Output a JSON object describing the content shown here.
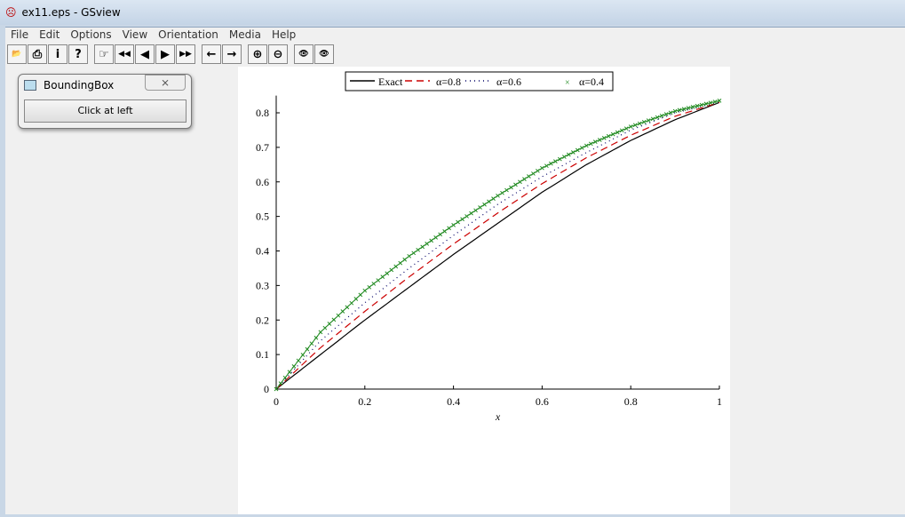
{
  "window": {
    "title": "ex11.eps - GSview"
  },
  "menu": [
    "File",
    "Edit",
    "Options",
    "View",
    "Orientation",
    "Media",
    "Help"
  ],
  "toolbar": [
    {
      "icon": "open-icon",
      "g": "📂"
    },
    {
      "icon": "print-icon",
      "g": "⎙"
    },
    {
      "icon": "info-icon",
      "g": "i"
    },
    {
      "icon": "help-icon",
      "g": "?"
    },
    {
      "icon": "goto-page-icon",
      "g": "☞"
    },
    {
      "icon": "first-page-icon",
      "g": "◀◀"
    },
    {
      "icon": "prev-page-icon",
      "g": "◀"
    },
    {
      "icon": "next-page-icon",
      "g": "▶"
    },
    {
      "icon": "last-page-icon",
      "g": "▶▶"
    },
    {
      "icon": "back-icon",
      "g": "←"
    },
    {
      "icon": "forward-icon",
      "g": "→"
    },
    {
      "icon": "zoom-in-icon",
      "g": "⊕"
    },
    {
      "icon": "zoom-out-icon",
      "g": "⊖"
    },
    {
      "icon": "text-search-icon",
      "g": "👁"
    },
    {
      "icon": "search-next-icon",
      "g": "👁"
    }
  ],
  "dialog": {
    "title": "BoundingBox",
    "close": "⨯",
    "button": "Click at left"
  },
  "chart_data": {
    "type": "line",
    "xlabel": "x",
    "ylabel": "",
    "xlim": [
      0,
      1
    ],
    "ylim": [
      0,
      0.85
    ],
    "xticks": [
      "0",
      "0.2",
      "0.4",
      "0.6",
      "0.8",
      "1"
    ],
    "yticks": [
      "0",
      "0.1",
      "0.2",
      "0.3",
      "0.4",
      "0.5",
      "0.6",
      "0.7",
      "0.8"
    ],
    "legend_position": "top",
    "x": [
      0,
      0.1,
      0.2,
      0.3,
      0.4,
      0.5,
      0.6,
      0.7,
      0.8,
      0.9,
      1
    ],
    "series": [
      {
        "name": "Exact",
        "style": "solid",
        "color": "#000000",
        "values": [
          0,
          0.1,
          0.2,
          0.295,
          0.39,
          0.48,
          0.57,
          0.65,
          0.72,
          0.78,
          0.83
        ]
      },
      {
        "name": "α=0.8",
        "style": "dash",
        "color": "#cc0000",
        "values": [
          0,
          0.12,
          0.225,
          0.325,
          0.42,
          0.51,
          0.595,
          0.67,
          0.735,
          0.79,
          0.83
        ]
      },
      {
        "name": "α=0.6",
        "style": "dot",
        "color": "#000066",
        "values": [
          0,
          0.14,
          0.25,
          0.35,
          0.445,
          0.535,
          0.615,
          0.685,
          0.75,
          0.8,
          0.83
        ]
      },
      {
        "name": "α=0.4",
        "style": "cross",
        "color": "#228b22",
        "values": [
          0,
          0.165,
          0.285,
          0.385,
          0.475,
          0.56,
          0.64,
          0.705,
          0.76,
          0.805,
          0.835
        ]
      }
    ]
  }
}
